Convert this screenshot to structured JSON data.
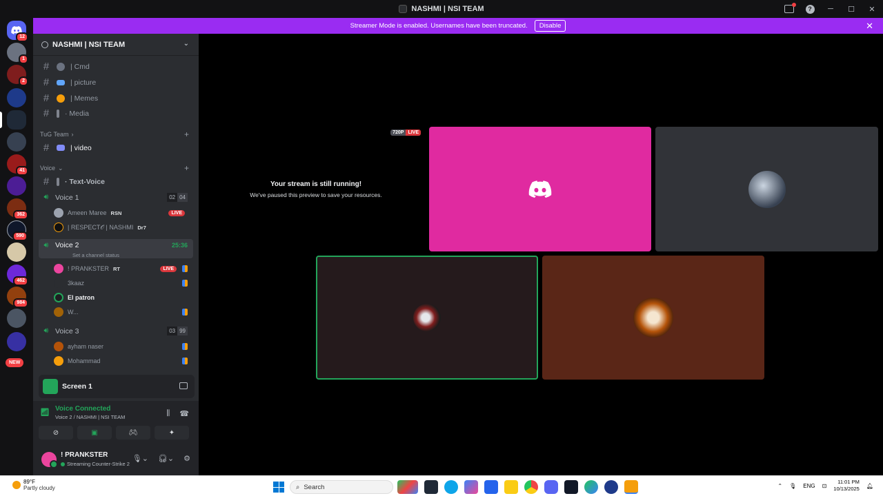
{
  "window": {
    "title": "NASHMI | NSI TEAM"
  },
  "banner": {
    "text": "Streamer Mode is enabled. Usernames have been truncated.",
    "disable_label": "Disable"
  },
  "rail": {
    "badges": [
      "12",
      "1",
      "2",
      "41",
      "362",
      "590",
      "462",
      "984"
    ],
    "new_label": "NEW"
  },
  "server": {
    "name": "NASHMI | NSI TEAM"
  },
  "channels": {
    "top": [
      {
        "label": "| Cmd"
      },
      {
        "label": "| picture"
      },
      {
        "label": "| Memes"
      },
      {
        "label": "· Media"
      }
    ],
    "category_tug": "TuG Team",
    "video": "| video",
    "category_voice": "Voice",
    "text_voice": "· Text-Voice"
  },
  "voice1": {
    "name": "Voice 1",
    "count_a": "02",
    "count_b": "04",
    "users": [
      {
        "name": "Ameen Maree",
        "tag": "RSN",
        "live": "LIVE"
      },
      {
        "name": "| RESPECT𝒪 | NASHMI",
        "tag": "Dr7"
      }
    ]
  },
  "voice2": {
    "name": "Voice 2",
    "timer": "25:36",
    "status_hint": "Set a channel status",
    "users": [
      {
        "name": "! PRANKSTER",
        "tag": "RT",
        "live": "LIVE"
      },
      {
        "name": "3kaaz"
      },
      {
        "name": "El patron"
      },
      {
        "name": "W..."
      }
    ]
  },
  "voice3": {
    "name": "Voice 3",
    "count_a": "03",
    "count_b": "99",
    "users": [
      {
        "name": "ayham naser"
      },
      {
        "name": "Mohammad"
      }
    ]
  },
  "screen_panel": {
    "label": "Screen 1"
  },
  "voice_panel": {
    "status": "Voice Connected",
    "location": "Voice 2 / NASHMI | NSI TEAM"
  },
  "user_panel": {
    "name": "! PRANKSTER",
    "activity": "Streaming Counter-Strike 2"
  },
  "stage": {
    "quality": "720P",
    "live": "LIVE",
    "paused_title": "Your stream is still running!",
    "paused_sub": "We've paused this preview to save your resources."
  },
  "taskbar": {
    "temp": "89°F",
    "weather": "Partly cloudy",
    "search": "Search",
    "lang": "ENG",
    "time": "11:01 PM",
    "date": "10/13/2025"
  },
  "colors": {
    "accent": "#9a2cf2",
    "discord_blurple": "#5865f2",
    "online_green": "#23a55a",
    "live_red": "#da373c",
    "tile_pink": "#e02aa0"
  }
}
